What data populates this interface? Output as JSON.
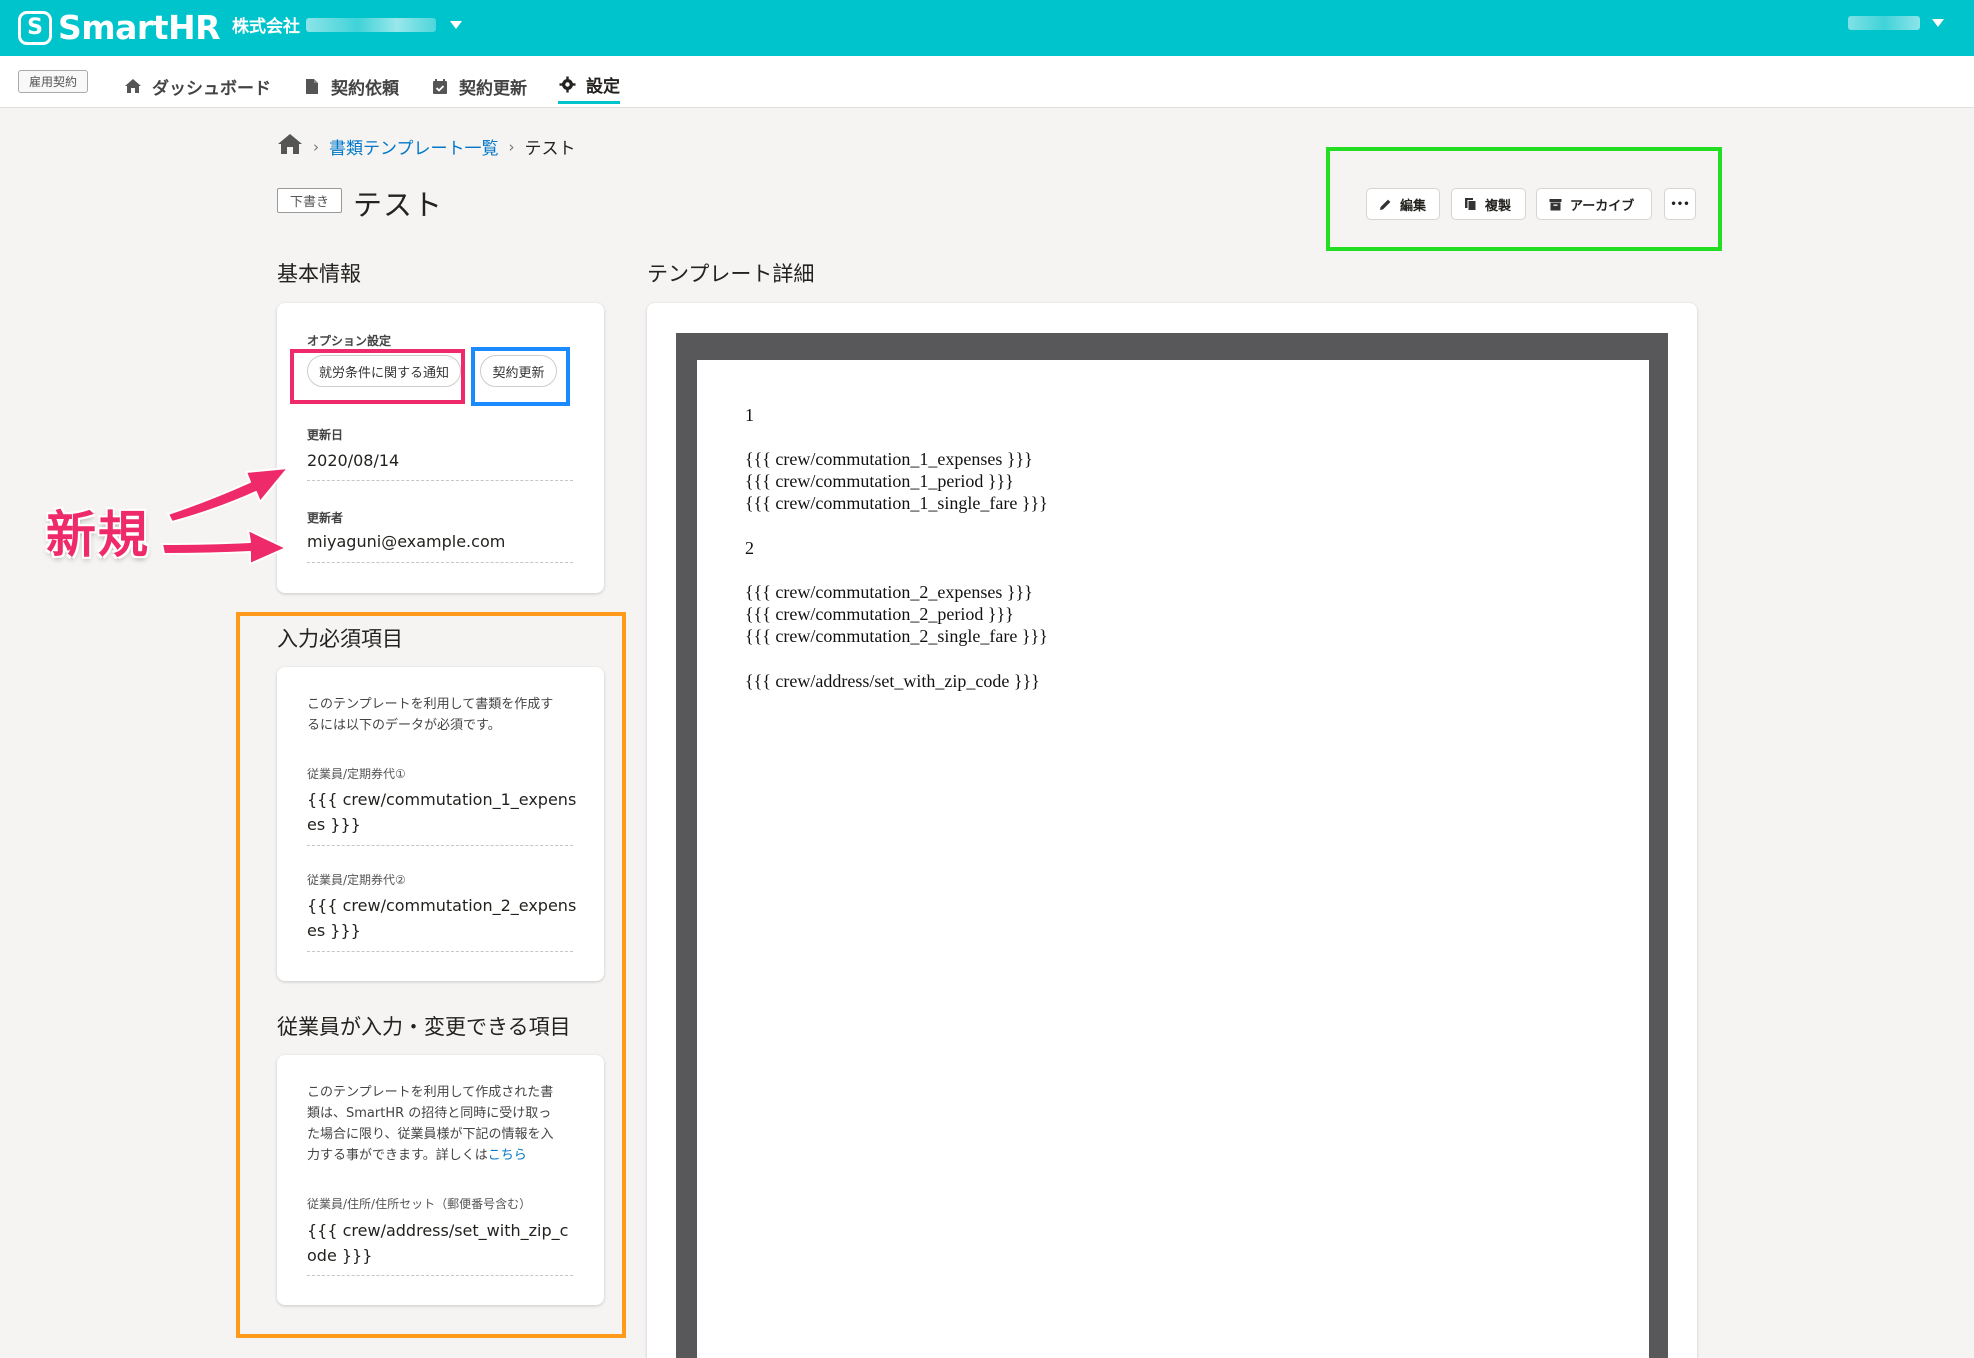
{
  "header": {
    "logo_mark": "S",
    "logo_text": "SmartHR",
    "company_prefix": "株式会社"
  },
  "subnav": {
    "app_badge": "雇用契約",
    "items": [
      {
        "label": "ダッシュボード",
        "icon": "home-icon"
      },
      {
        "label": "契約依頼",
        "icon": "document-icon"
      },
      {
        "label": "契約更新",
        "icon": "calendar-check-icon"
      },
      {
        "label": "設定",
        "icon": "gear-icon",
        "active": true
      }
    ]
  },
  "breadcrumb": {
    "home_icon": "home-icon",
    "link": "書類テンプレート一覧",
    "current": "テスト"
  },
  "title": {
    "badge": "下書き",
    "text": "テスト"
  },
  "actions": {
    "edit": "編集",
    "duplicate": "複製",
    "archive": "アーカイブ",
    "more": "•••"
  },
  "basic_info": {
    "title": "基本情報",
    "option_label": "オプション設定",
    "option_chips": [
      "就労条件に関する通知",
      "契約更新"
    ],
    "updated_date_label": "更新日",
    "updated_date": "2020/08/14",
    "updated_by_label": "更新者",
    "updated_by": "miyaguni@example.com"
  },
  "annotation": {
    "new_label": "新規"
  },
  "required_fields": {
    "title": "入力必須項目",
    "description_line1": "このテンプレートを利用して書類を作成す",
    "description_line2": "るには以下のデータが必須です。",
    "items": [
      {
        "label": "従業員/定期券代①",
        "value_line1": "{{{ crew/commutation_1_expens",
        "value_line2": "es }}}"
      },
      {
        "label": "従業員/定期券代②",
        "value_line1": "{{{ crew/commutation_2_expens",
        "value_line2": "es }}}"
      }
    ]
  },
  "editable_fields": {
    "title": "従業員が入力・変更できる項目",
    "description_line1": "このテンプレートを利用して作成された書",
    "description_line2": "類は、SmartHR の招待と同時に受け取っ",
    "description_line3": "た場合に限り、従業員様が下記の情報を入",
    "description_line4_prefix": "力する事ができます。詳しくは",
    "description_link": "こちら",
    "items": [
      {
        "label": "従業員/住所/住所セット（郵便番号含む）",
        "value_line1": "{{{ crew/address/set_with_zip_c",
        "value_line2": "ode }}}"
      }
    ]
  },
  "template_detail": {
    "title": "テンプレート詳細",
    "lines": [
      "1",
      "{{{ crew/commutation_1_expenses }}}",
      "{{{ crew/commutation_1_period }}}",
      "{{{ crew/commutation_1_single_fare }}}",
      "2",
      "{{{ crew/commutation_2_expenses }}}",
      "{{{ crew/commutation_2_period }}}",
      "{{{ crew/commutation_2_single_fare }}}",
      "{{{ crew/address/set_with_zip_code }}}"
    ]
  }
}
